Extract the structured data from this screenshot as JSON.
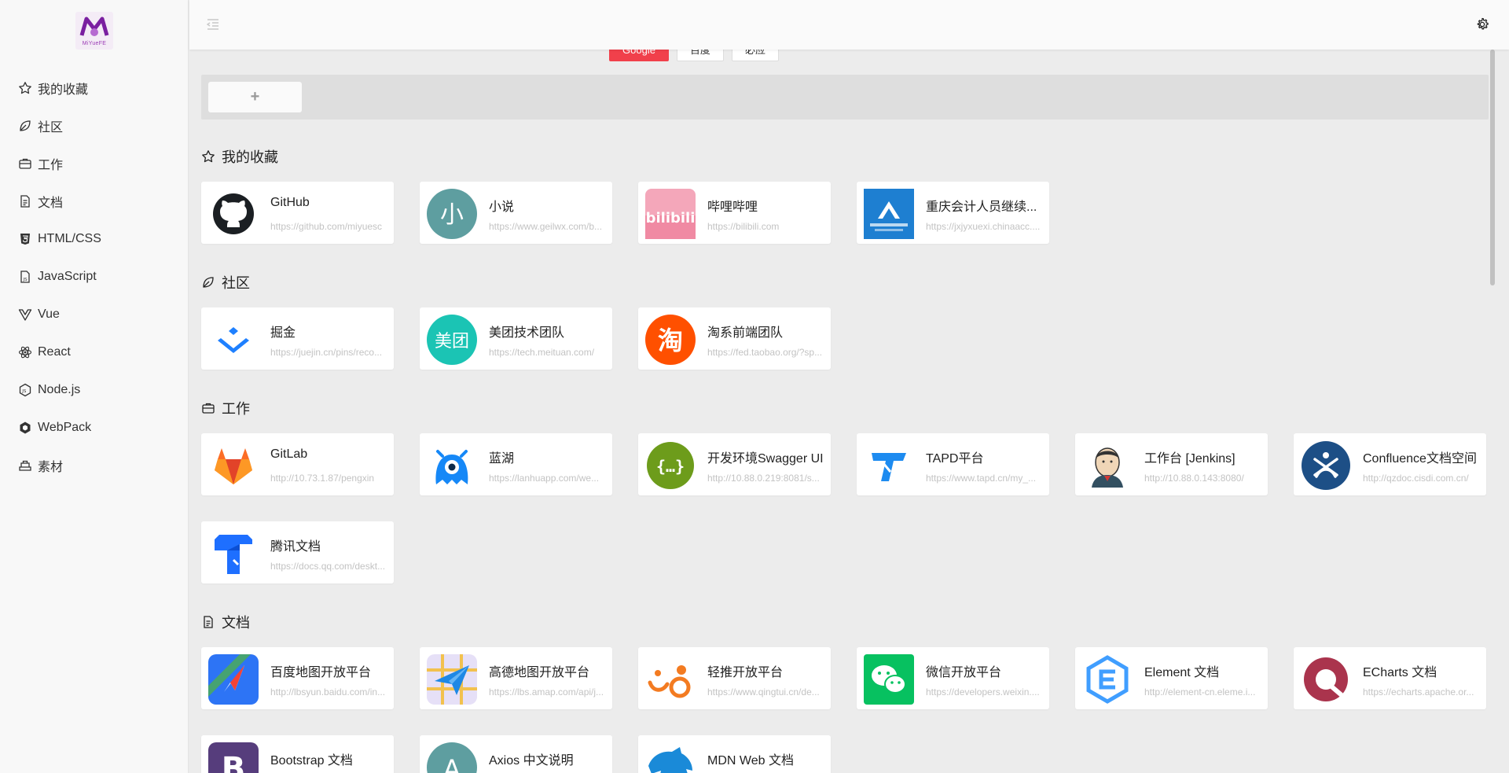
{
  "logo": {
    "text": "MiYueFE",
    "color": "#9b3bb5"
  },
  "sidebar": {
    "items": [
      {
        "label": "我的收藏",
        "icon": "star-icon"
      },
      {
        "label": "社区",
        "icon": "leaf-icon"
      },
      {
        "label": "工作",
        "icon": "briefcase-icon"
      },
      {
        "label": "文档",
        "icon": "document-icon"
      },
      {
        "label": "HTML/CSS",
        "icon": "html5-icon"
      },
      {
        "label": "JavaScript",
        "icon": "js-file-icon"
      },
      {
        "label": "Vue",
        "icon": "vue-icon"
      },
      {
        "label": "React",
        "icon": "react-icon"
      },
      {
        "label": "Node.js",
        "icon": "nodejs-icon"
      },
      {
        "label": "WebPack",
        "icon": "webpack-icon"
      },
      {
        "label": "素材",
        "icon": "material-icon"
      }
    ]
  },
  "header": {
    "collapse_icon": "menu-fold-icon",
    "settings_icon": "gear-icon"
  },
  "search": {
    "engines": [
      "Google",
      "百度",
      "必应"
    ],
    "active_engine": "Google",
    "add_label": "+",
    "accent": "#f1404b"
  },
  "sections": [
    {
      "title": "我的收藏",
      "icon": "star-icon",
      "cards": [
        {
          "name": "GitHub",
          "url": "https://github.com/miyuesc",
          "icon": "github-icon"
        },
        {
          "name": "小说",
          "url": "https://www.geilwx.com/b...",
          "icon": "novel-icon"
        },
        {
          "name": "哔哩哔哩",
          "url": "https://bilibili.com",
          "icon": "bilibili-icon"
        },
        {
          "name": "重庆会计人员继续...",
          "url": "https://jxjyxuexi.chinaacc....",
          "icon": "chinaacc-icon"
        }
      ]
    },
    {
      "title": "社区",
      "icon": "leaf-icon",
      "cards": [
        {
          "name": "掘金",
          "url": "https://juejin.cn/pins/reco...",
          "icon": "juejin-icon"
        },
        {
          "name": "美团技术团队",
          "url": "https://tech.meituan.com/",
          "icon": "meituan-icon"
        },
        {
          "name": "淘系前端团队",
          "url": "https://fed.taobao.org/?sp...",
          "icon": "taobao-icon"
        }
      ]
    },
    {
      "title": "工作",
      "icon": "briefcase-icon",
      "cards": [
        {
          "name": "GitLab",
          "url": "http://10.73.1.87/pengxin",
          "icon": "gitlab-icon"
        },
        {
          "name": "蓝湖",
          "url": "https://lanhuapp.com/we...",
          "icon": "lanhu-icon"
        },
        {
          "name": "开发环境Swagger UI",
          "url": "http://10.88.0.219:8081/s...",
          "icon": "swagger-icon"
        },
        {
          "name": "TAPD平台",
          "url": "https://www.tapd.cn/my_...",
          "icon": "tapd-icon"
        },
        {
          "name": "工作台 [Jenkins]",
          "url": "http://10.88.0.143:8080/",
          "icon": "jenkins-icon"
        },
        {
          "name": "Confluence文档空间",
          "url": "http://qzdoc.cisdi.com.cn/",
          "icon": "confluence-icon"
        },
        {
          "name": "腾讯文档",
          "url": "https://docs.qq.com/deskt...",
          "icon": "tencent-docs-icon"
        }
      ]
    },
    {
      "title": "文档",
      "icon": "document-icon",
      "cards": [
        {
          "name": "百度地图开放平台",
          "url": "http://lbsyun.baidu.com/in...",
          "icon": "baidu-map-icon"
        },
        {
          "name": "高德地图开放平台",
          "url": "https://lbs.amap.com/api/j...",
          "icon": "amap-icon"
        },
        {
          "name": "轻推开放平台",
          "url": "https://www.qingtui.cn/de...",
          "icon": "qingtui-icon"
        },
        {
          "name": "微信开放平台",
          "url": "https://developers.weixin....",
          "icon": "wechat-icon"
        },
        {
          "name": "Element 文档",
          "url": "http://element-cn.eleme.i...",
          "icon": "element-icon"
        },
        {
          "name": "ECharts 文档",
          "url": "https://echarts.apache.or...",
          "icon": "echarts-icon"
        },
        {
          "name": "Bootstrap 文档",
          "url": "",
          "icon": "bootstrap-icon"
        },
        {
          "name": "Axios 中文说明",
          "url": "",
          "icon": "axios-icon"
        },
        {
          "name": "MDN Web 文档",
          "url": "",
          "icon": "mdn-icon"
        }
      ]
    }
  ]
}
